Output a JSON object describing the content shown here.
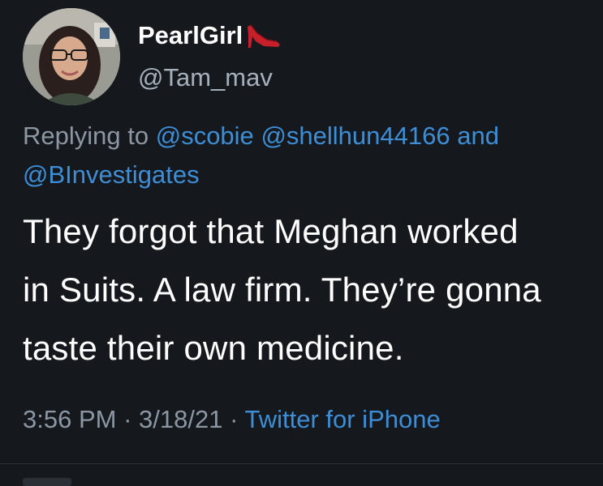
{
  "author": {
    "display_name": "PearlGirl",
    "emoji_icon": "high-heel-shoe-icon",
    "handle": "@Tam_mav"
  },
  "reply": {
    "prefix": "Replying to",
    "mentions_line1": [
      "@scobie",
      "@shellhun44166"
    ],
    "conjunction": "and",
    "mentions_line2": [
      "@BInvestigates"
    ]
  },
  "body": {
    "lines": [
      "They forgot that Meghan worked",
      "in Suits. A law firm. They’re gonna",
      "taste their own medicine."
    ]
  },
  "meta": {
    "time": "3:56 PM",
    "separator": "·",
    "date": "3/18/21",
    "source": "Twitter for iPhone"
  },
  "colors": {
    "background": "#15181d",
    "link": "#3d8ed6",
    "muted": "#8c97a3",
    "heel": "#c8202a"
  }
}
